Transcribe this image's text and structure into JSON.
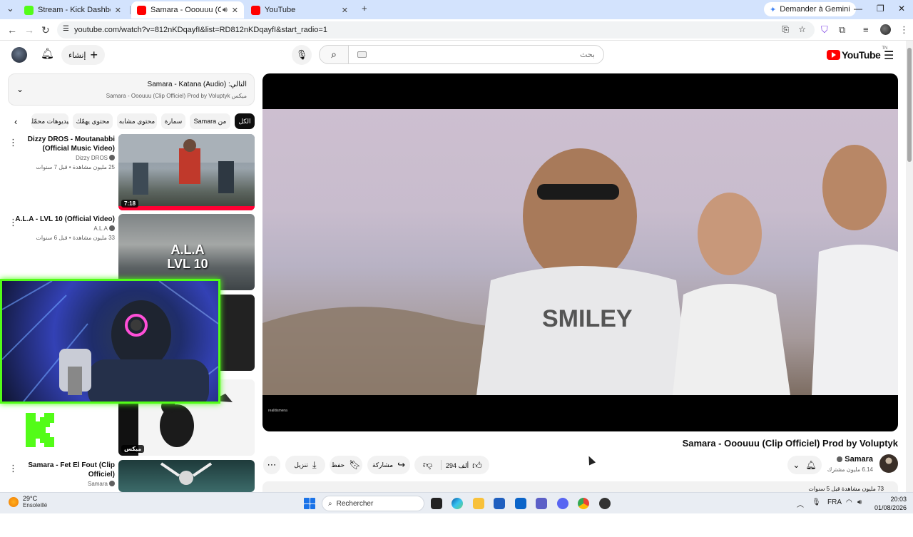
{
  "browser": {
    "tabs": [
      {
        "title": "Stream - Kick Dashboard",
        "favicon_color": "#53fc18"
      },
      {
        "title": "Samara - Ooouuu (Clip Offi",
        "favicon_color": "#ff0000",
        "active": true
      },
      {
        "title": "YouTube",
        "favicon_color": "#ff0000"
      }
    ],
    "new_tab": "+",
    "gemini_label": "Demander à Gemini",
    "url": "youtube.com/watch?v=812nKDqayfI&list=RD812nKDqayfI&start_radio=1"
  },
  "masthead": {
    "create_label": "إنشاء",
    "search_placeholder": "بحث",
    "logo_text": "YouTube",
    "logo_region": "TN"
  },
  "upnext": {
    "line1": "التالي: Samara - Katana (Audio)",
    "line2": "ميكس Samara - Ooouuu (Clip Officiel) Prod by Voluptyk"
  },
  "chips": [
    "الكل",
    "من Samara",
    "سمارة",
    "محتوى مشابه",
    "محتوى يهمّك",
    "فيديوهات محمّلة"
  ],
  "recommendations": [
    {
      "title": "Dizzy DROS - Moutanabbi (Official Music Video)",
      "channel": "Dizzy DROS",
      "meta": "25 مليون مشاهدة • قبل 7 سنوات",
      "duration": "7:18"
    },
    {
      "title": "A.L.A - LVL 10 (Official Video)",
      "channel": "A.L.A",
      "meta": "33 مليون مشاهدة • قبل 6 سنوات",
      "thumb_text": "A.L.A LVL 10"
    },
    {
      "badge": "ميكس"
    },
    {
      "title": "Samara - Fet El Fout (Clip Officiel)",
      "channel": "Samara"
    }
  ],
  "video": {
    "title": "Samara - Ooouuu (Clip Officiel) Prod by Voluptyk",
    "watermark": "realitismena",
    "likes": "294 ألف",
    "share": "مشاركة",
    "save": "حفظ",
    "download": "تنزيل",
    "channel": "Samara",
    "subscribers": "6.14 مليون مشترك",
    "description_snippet": "73 مليون مشاهدة قبل 5 سنوات"
  },
  "taskbar": {
    "temp": "29°C",
    "weather": "Ensoleillé",
    "search_label": "Rechercher",
    "lang": "FRA",
    "time": "20:03",
    "date": "01/08/2026"
  }
}
